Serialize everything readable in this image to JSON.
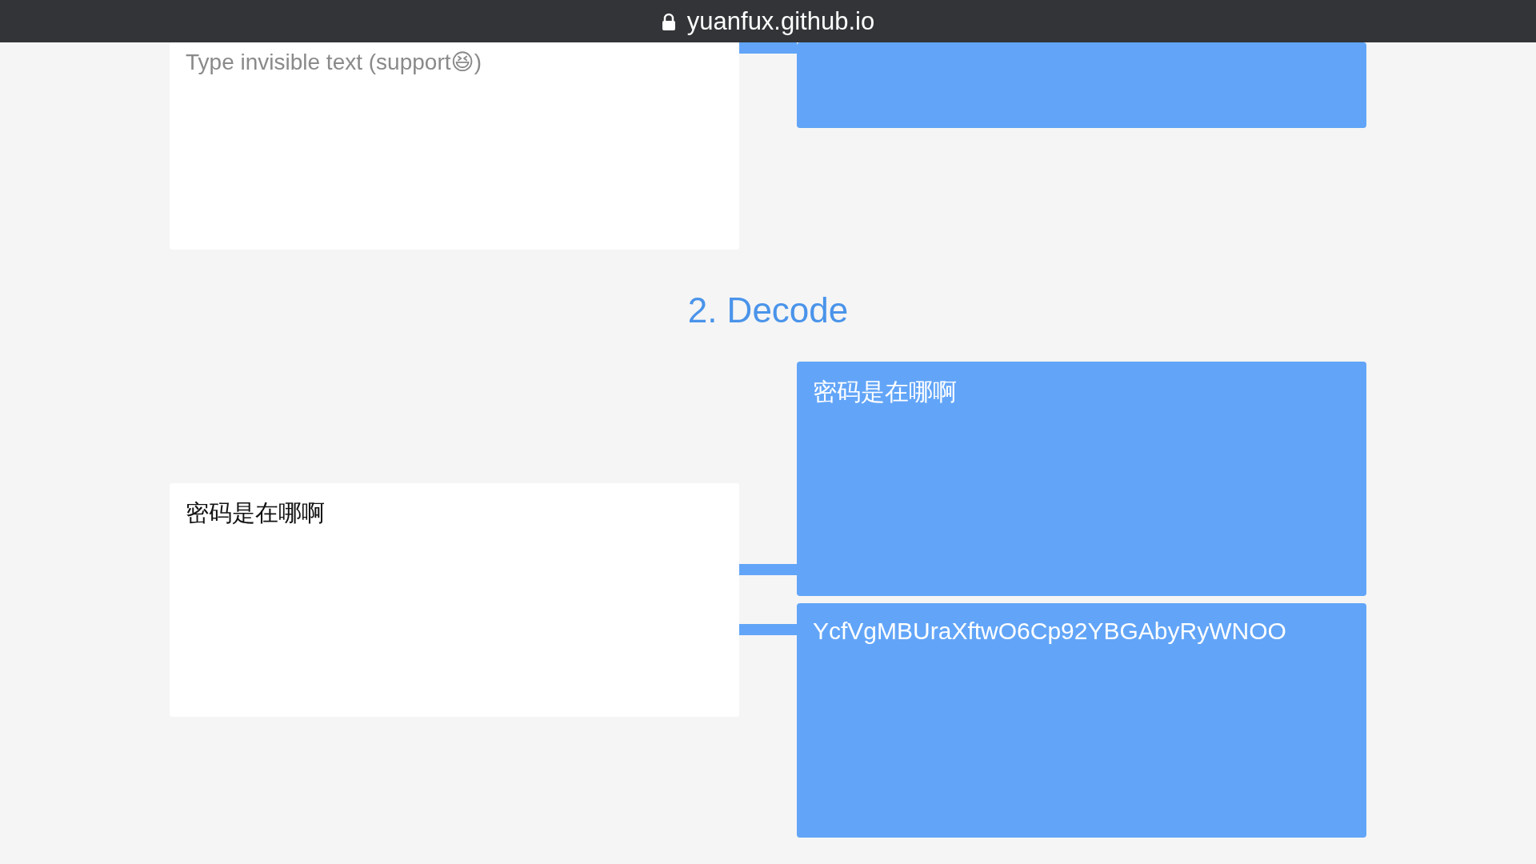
{
  "top_bar": {
    "domain": "yuanfux.github.io"
  },
  "encode": {
    "input": {
      "placeholder": "Type invisible text (support😆)"
    }
  },
  "decode": {
    "heading": "2. Decode",
    "input": {
      "value": "密码是在哪啊"
    },
    "outputs": [
      "密码是在哪啊",
      "YcfVgMBUraXftwO6Cp92YBGAbyRyWNOO"
    ]
  }
}
